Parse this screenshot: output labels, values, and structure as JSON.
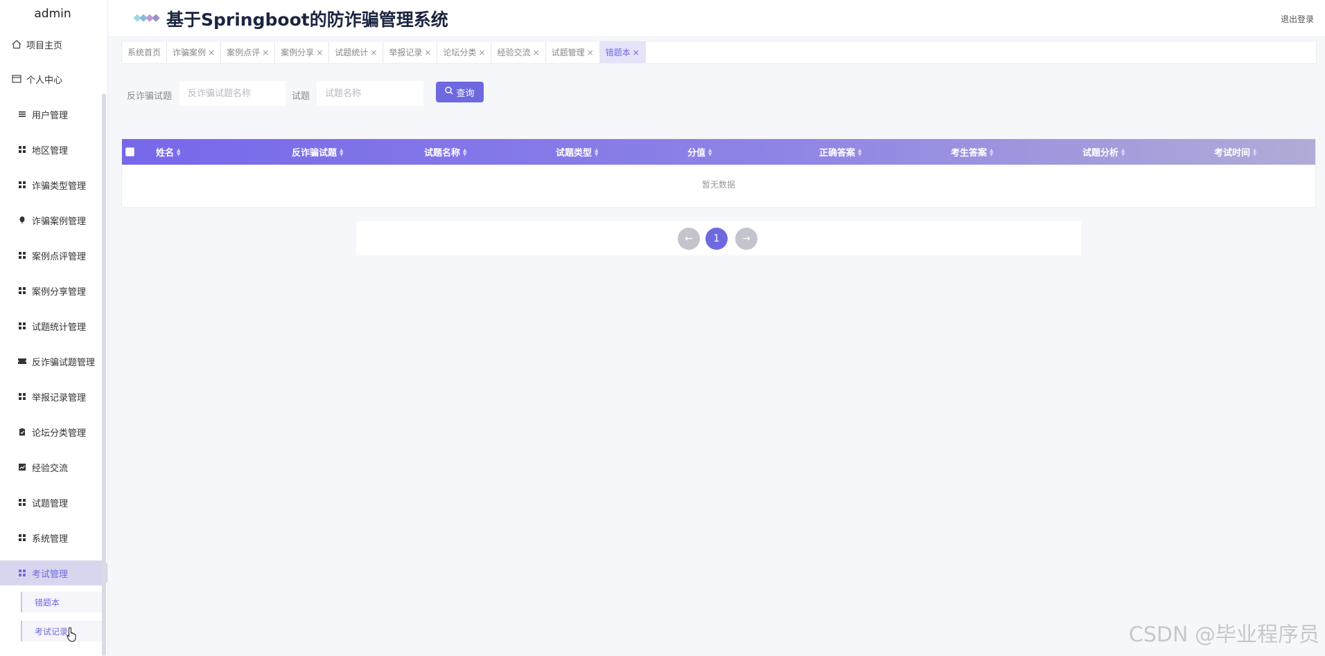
{
  "sidebar": {
    "user": "admin",
    "top_items": [
      {
        "label": "项目主页",
        "icon": "home-icon"
      },
      {
        "label": "个人中心",
        "icon": "id-card-icon"
      }
    ],
    "items": [
      {
        "label": "用户管理",
        "icon": "list-icon"
      },
      {
        "label": "地区管理",
        "icon": "grid-icon"
      },
      {
        "label": "诈骗类型管理",
        "icon": "grid-icon"
      },
      {
        "label": "诈骗案例管理",
        "icon": "balloon-icon"
      },
      {
        "label": "案例点评管理",
        "icon": "grid-icon"
      },
      {
        "label": "案例分享管理",
        "icon": "grid-icon"
      },
      {
        "label": "试题统计管理",
        "icon": "grid-icon"
      },
      {
        "label": "反诈骗试题管理",
        "icon": "ticket-icon"
      },
      {
        "label": "举报记录管理",
        "icon": "grid-icon"
      },
      {
        "label": "论坛分类管理",
        "icon": "clipboard-icon"
      },
      {
        "label": "经验交流",
        "icon": "chart-icon"
      },
      {
        "label": "试题管理",
        "icon": "grid-icon"
      },
      {
        "label": "系统管理",
        "icon": "grid-icon"
      },
      {
        "label": "考试管理",
        "icon": "grid-icon"
      }
    ],
    "sub_items": [
      {
        "label": "错题本"
      },
      {
        "label": "考试记录"
      }
    ]
  },
  "header": {
    "title": "基于Springboot的防诈骗管理系统",
    "logout": "退出登录"
  },
  "tabs": [
    {
      "label": "系统首页",
      "closable": false
    },
    {
      "label": "诈骗案例",
      "closable": true
    },
    {
      "label": "案例点评",
      "closable": true
    },
    {
      "label": "案例分享",
      "closable": true
    },
    {
      "label": "试题统计",
      "closable": true
    },
    {
      "label": "举报记录",
      "closable": true
    },
    {
      "label": "论坛分类",
      "closable": true
    },
    {
      "label": "经验交流",
      "closable": true
    },
    {
      "label": "试题管理",
      "closable": true
    },
    {
      "label": "错题本",
      "closable": true,
      "active": true
    }
  ],
  "search": {
    "field1_label": "反诈骗试题",
    "field1_placeholder": "反诈骗试题名称",
    "field2_label": "试题",
    "field2_placeholder": "试题名称",
    "query_label": "查询"
  },
  "table": {
    "columns": [
      "姓名",
      "反诈骗试题",
      "试题名称",
      "试题类型",
      "分值",
      "正确答案",
      "考生答案",
      "试题分析",
      "考试时间"
    ],
    "empty_text": "暂无数据"
  },
  "pagination": {
    "prev": "←",
    "current": "1",
    "next": "→"
  },
  "watermark": "CSDN @毕业程序员",
  "colors": {
    "accent": "#6f69e0",
    "header_gradient_start": "#7668ea",
    "header_gradient_end": "#b0acd6"
  }
}
